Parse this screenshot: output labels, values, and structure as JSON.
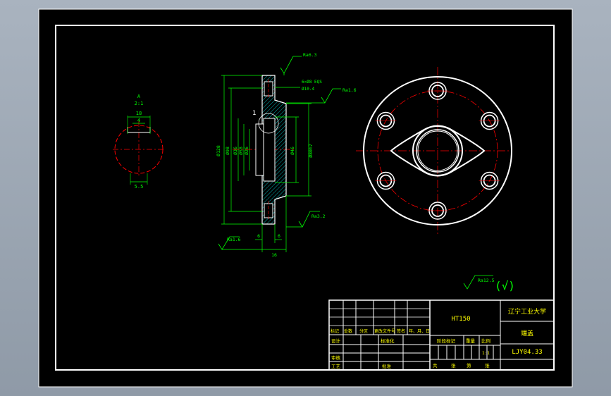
{
  "colors": {
    "background": "#000000",
    "line": "#ffffff",
    "dimension": "#00ff00",
    "centerline": "#ff0000",
    "hatch": "#00ffff",
    "annotation": "#ffff00"
  },
  "detail_view": {
    "label": "A",
    "scale": "2:1",
    "dim_width": "18",
    "dim_top": "4",
    "dim_bottom": "5.5"
  },
  "section_view": {
    "section_mark": "1",
    "roughness": [
      "Ra6.3",
      "Ra1.6",
      "Ra3.2",
      "Ra1.6"
    ],
    "hole_note_1": "6×Ø8 EQS",
    "hole_note_2": "Ø10.4",
    "dims_left": [
      "Ø128",
      "Ø98",
      "Ø36",
      "Ø58",
      "Ø26"
    ],
    "dims_right": [
      "Ø46",
      "Ø80h7"
    ],
    "dim_bottom_a": "6",
    "dim_bottom_b": "6",
    "dim_bottom_total": "16"
  },
  "general_roughness": {
    "value": "Ra12.5",
    "bracket": "(√)"
  },
  "title_block": {
    "material": "HT150",
    "school": "辽宁工业大学",
    "part_name": "端盖",
    "drawing_number": "LJY04.33",
    "revision_headers": [
      "标记",
      "处数",
      "分区",
      "更改文件号",
      "签名",
      "年、月、日"
    ],
    "design": "设计",
    "standard": "标准化",
    "review": "审核",
    "process": "工艺",
    "approve": "批准",
    "stage": "阶段标记",
    "weight": "重量",
    "scale_head": "比例",
    "scale": "1:1",
    "sheets_total": "共",
    "sheets_label": "张",
    "sheet_no": "第",
    "sheet_label": "张"
  }
}
